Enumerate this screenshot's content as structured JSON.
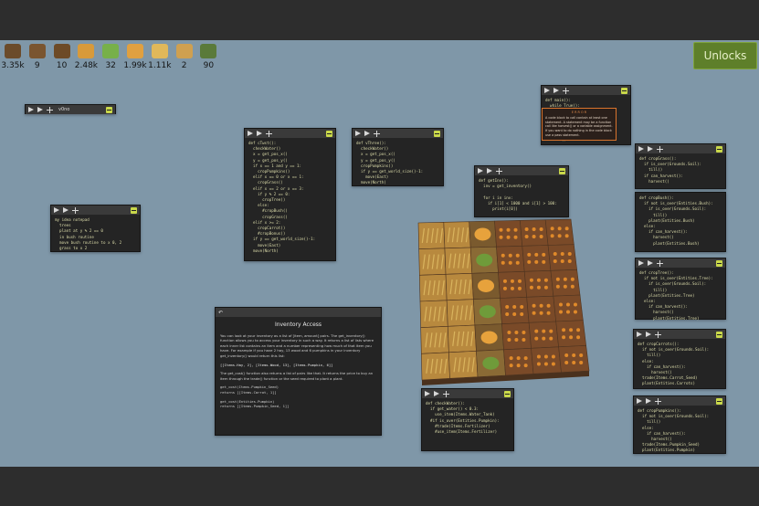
{
  "resources": [
    {
      "icon": "hay-icon",
      "value": "3.35k",
      "color": "#6b4b2a"
    },
    {
      "icon": "wood-icon",
      "value": "9",
      "color": "#7a5530"
    },
    {
      "icon": "barrel-icon",
      "value": "10",
      "color": "#6d4a26"
    },
    {
      "icon": "pumpkin-icon",
      "value": "2.48k",
      "color": "#d89a3a"
    },
    {
      "icon": "cactus-icon",
      "value": "32",
      "color": "#77b04a"
    },
    {
      "icon": "carrot-icon",
      "value": "1.99k",
      "color": "#e0a040"
    },
    {
      "icon": "grain-icon",
      "value": "1.11k",
      "color": "#e0b85a"
    },
    {
      "icon": "power-icon",
      "value": "2",
      "color": "#cfa050"
    },
    {
      "icon": "water-icon",
      "value": "90",
      "color": "#5a7a3a"
    }
  ],
  "unlocks_label": "Unlocks",
  "windows": {
    "w_v0no": {
      "name": "v0no",
      "lines": []
    },
    "w_notepad": {
      "lines": [
        "my idea notepad",
        "  trees",
        "  plant at y % 2 == 0",
        "  in bush routine",
        "  move bush routine to x 0, 2",
        "  grass to x 2"
      ]
    },
    "w_ctwst": {
      "lines": [
        "def cTwst():",
        "  checkWater()",
        "  x = get_pos_x()",
        "  y = get_pos_y()",
        "  if x == 1 and y == 1:",
        "    cropPumpkins()",
        "  elif x == 0 or x == 1:",
        "    cropGrass()",
        "  elif x == 2 or x == 3:",
        "    if y % 2 == 0:",
        "      cropTree()",
        "    else:",
        "      #cropBush()",
        "      cropGrass()",
        "  elif x >= 2:",
        "    cropCarrot()",
        "    #cropBonus()",
        "  if y == get_world_size()-1:",
        "    move(East)",
        "  move(North)"
      ]
    },
    "w_vthree": {
      "lines": [
        "def vThree():",
        "  checkWater()",
        "  x = get_pos_x()",
        "  y = get_pos_y()",
        "  cropPumpkins()",
        "  if y == get_world_size()-1:",
        "    move(East)",
        "  move(North)"
      ]
    },
    "w_main": {
      "lines": [
        "def main():",
        "  while True():",
        "",
        "",
        "",
        "",
        "",
        "  clear()"
      ]
    },
    "w_getinv": {
      "lines": [
        "def getInv():",
        "  inv = get_inventory()",
        "",
        "  for i in inv:",
        "    if i[1] < 1000 and i[1] > 100:",
        "      print(i[0])"
      ]
    },
    "w_checkwater": {
      "lines": [
        "def checkWater():",
        "  if get_water() < 0.3:",
        "    use_item(Items.Water_Tank)",
        "  #if is_over(Entities.Pumpkin):",
        "    #trade(Items.Fertilizer)",
        "    #use_item(Items.Fertilizer)"
      ]
    },
    "w_cropgrass": {
      "lines": [
        "def cropGrass():",
        "  if is_over(Grounds.Soil):",
        "    till()",
        "  if can_harvest():",
        "    harvest()"
      ]
    },
    "w_cropbush": {
      "lines": [
        "def cropBush():",
        "  if not is_over(Entities.Bush):",
        "    if is_over(Grounds.Soil):",
        "      till()",
        "    plant(Entities.Bush)",
        "  else:",
        "    if can_harvest():",
        "      harvest()",
        "      plant(Entities.Bush)"
      ]
    },
    "w_croptree": {
      "lines": [
        "def cropTree():",
        "  if not is_over(Entities.Tree):",
        "    if is_over(Grounds.Soil):",
        "      till()",
        "    plant(Entities.Tree)",
        "  else:",
        "    if can_harvest():",
        "      harvest()",
        "      plant(Entities.Tree)"
      ]
    },
    "w_cropcarrots": {
      "lines": [
        "def cropCarrots():",
        "  if not is_over(Grounds.Soil):",
        "    till()",
        "  else:",
        "    if can_harvest():",
        "      harvest()",
        "  trade(Items.Carrot_Seed)",
        "  plant(Entities.Carrots)"
      ]
    },
    "w_croppumpkin": {
      "lines": [
        "def cropPumpkins():",
        "  if not is_over(Grounds.Soil):",
        "    till()",
        "  else:",
        "    if can_harvest():",
        "      harvest()",
        "  trade(Items.Pumpkin_Seed)",
        "  plant(Entities.Pumpkin)"
      ]
    }
  },
  "tooltip": {
    "title": "E R R O R",
    "text": "A code block to call contain at least one statement. A statement may be a function call like harvest() or a variable assignment. If you want to do nothing in the code block use a pass statement."
  },
  "inventory_doc": {
    "title": "Inventory Access",
    "p1": "You can look at your inventory as a list of [item, amount] pairs. The get_inventory() function allows you to access your inventory in such a way. It returns a list of lists where each inner list contains an item and a number representing how much of that item you have. For example if you have 2 hay, 13 wood and 6 pumpkins in your inventory get_inventory() would return this list:",
    "p2": "[[Items.Hay, 2], [Items.Wood, 13], [Items.Pumpkin, 6]]",
    "p3": "The get_cost() function also returns a list of pairs like that. It returns the price to buy an item through the trade() function or the seed required to plant a plant.",
    "p4": "get_cost(Items.Pumpkin_Seed)\nreturns [[Items.Carrot, 1]]",
    "p5": "get_cost(Entities.Pumpkin)\nreturns [[Items.Pumpkin_Seed, 1]]"
  }
}
